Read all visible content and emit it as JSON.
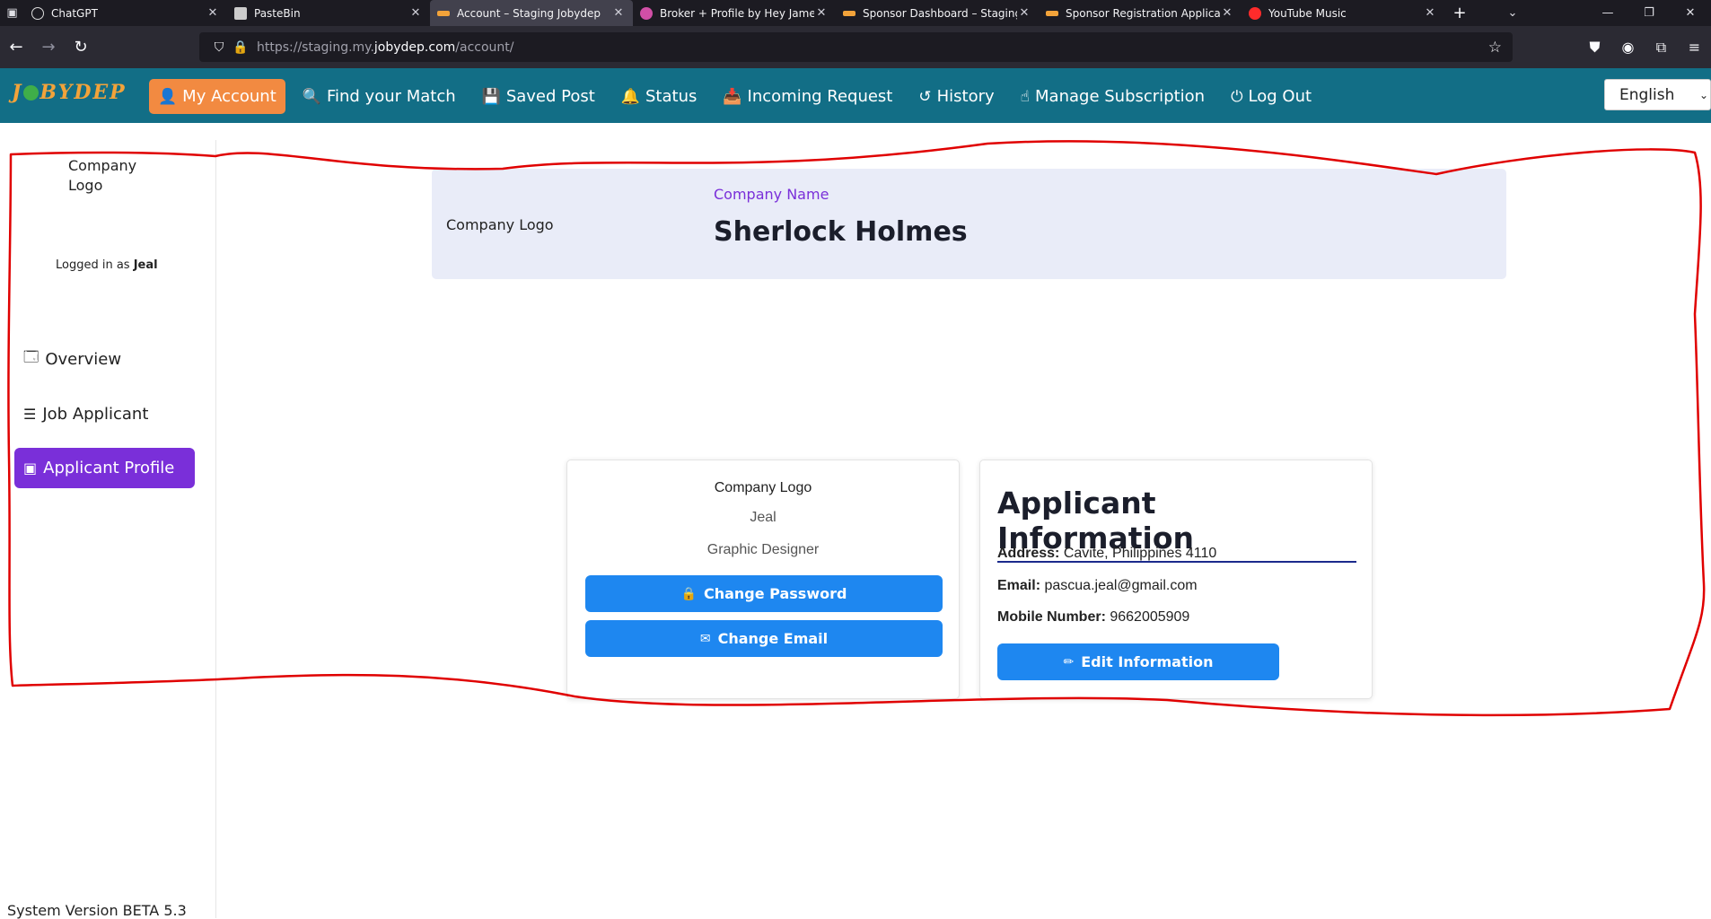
{
  "browser": {
    "tabs": [
      {
        "title": "ChatGPT",
        "fav_color": "#3a3a3a"
      },
      {
        "title": "PasteBin",
        "fav_color": "#3a3a3a"
      },
      {
        "title": "Account – Staging Jobydep",
        "fav_color": "#f2a33a"
      },
      {
        "title": "Broker + Profile by Hey James! c",
        "fav_color": "#d14fa6"
      },
      {
        "title": "Sponsor Dashboard – Staging Jo",
        "fav_color": "#f2a33a"
      },
      {
        "title": "Sponsor Registration Applicant",
        "fav_color": "#f2a33a"
      },
      {
        "title": "YouTube Music",
        "fav_color": "#ff2b2b"
      }
    ],
    "url_prefix": "https://staging.my.",
    "url_domain": "jobydep.com",
    "url_path": "/account/"
  },
  "header": {
    "logo_text_a": "J",
    "logo_text_b": "BYDEP",
    "menu": [
      {
        "label": "My Account",
        "icon": "user-icon",
        "glyph": "👤"
      },
      {
        "label": "Find your Match",
        "icon": "search-icon",
        "glyph": "🔍"
      },
      {
        "label": "Saved Post",
        "icon": "save-icon",
        "glyph": "💾"
      },
      {
        "label": "Status",
        "icon": "bell-icon",
        "glyph": "🔔"
      },
      {
        "label": "Incoming Request",
        "icon": "inbox-icon",
        "glyph": "📥"
      },
      {
        "label": "History",
        "icon": "history-icon",
        "glyph": "↺"
      },
      {
        "label": "Manage Subscription",
        "icon": "hand-icon",
        "glyph": "☝"
      },
      {
        "label": "Log Out",
        "icon": "power-icon",
        "glyph": "⏻"
      }
    ],
    "language": "English"
  },
  "sidebar": {
    "logo_text": "Company Logo",
    "logged_prefix": "Logged in as",
    "logged_user": "Jeal",
    "items": [
      {
        "label": "Overview",
        "icon": "dashboard-icon"
      },
      {
        "label": "Job Applicant",
        "icon": "list-icon"
      },
      {
        "label": "Applicant Profile",
        "icon": "profile-icon"
      }
    ],
    "version": "System Version BETA 5.3"
  },
  "banner": {
    "logo_text": "Company Logo",
    "label": "Company Name",
    "name": "Sherlock Holmes"
  },
  "profile_card": {
    "logo_text": "Company Logo",
    "name": "Jeal",
    "role": "Graphic Designer",
    "change_password": "Change Password",
    "change_email": "Change Email"
  },
  "info_card": {
    "title": "Applicant Information",
    "address_label": "Address:",
    "address": "Cavite, Philippines 4110",
    "email_label": "Email:",
    "email": "pascua.jeal@gmail.com",
    "mobile_label": "Mobile Number:",
    "mobile": "9662005909",
    "edit_button": "Edit Information"
  },
  "colors": {
    "header_bg": "#126e86",
    "active_menu": "#f28a41",
    "accent_purple": "#7a2fd9",
    "button_blue": "#1e87f0",
    "annotation_red": "#e00000"
  }
}
